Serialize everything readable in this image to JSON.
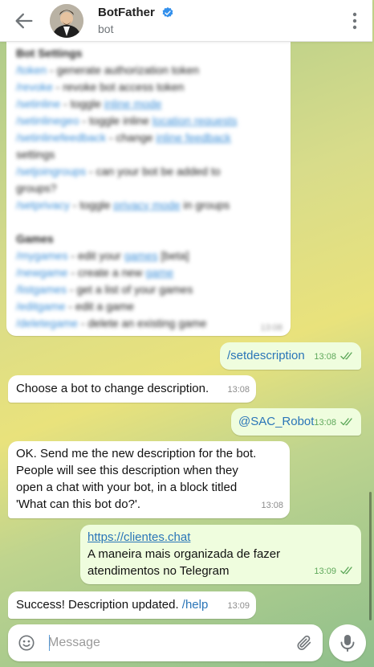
{
  "header": {
    "title": "BotFather",
    "subtitle": "bot",
    "back_icon": "arrow-left-icon",
    "verified_icon": "verified-badge-icon",
    "menu_icon": "more-vertical-icon"
  },
  "previous_message": {
    "lines": [
      {
        "kind": "section",
        "text": "Bot Settings"
      },
      {
        "kind": "line",
        "cmd": "/token",
        "text": " - generate authorization token"
      },
      {
        "kind": "line",
        "cmd": "/revoke",
        "text": " - revoke bot access token"
      },
      {
        "kind": "line",
        "cmd": "/setinline",
        "text": " - toggle ",
        "link": "inline mode"
      },
      {
        "kind": "line",
        "cmd": "/setinlinegeo",
        "text": " - toggle inline ",
        "link": "location requests"
      },
      {
        "kind": "line",
        "cmd": "/setinlinefeedback",
        "text": " - change ",
        "link": "inline feedback"
      },
      {
        "kind": "plain",
        "text": "settings"
      },
      {
        "kind": "line",
        "cmd": "/setjoingroups",
        "text": " - can your bot be added to"
      },
      {
        "kind": "plain",
        "text": "groups?"
      },
      {
        "kind": "line",
        "cmd": "/setprivacy",
        "text": " - toggle ",
        "link": "privacy mode",
        "after": " in groups"
      },
      {
        "kind": "blank",
        "text": ""
      },
      {
        "kind": "section",
        "text": "Games"
      },
      {
        "kind": "line",
        "cmd": "/mygames",
        "text": " - edit your ",
        "link": "games",
        "after": " [beta]"
      },
      {
        "kind": "line",
        "cmd": "/newgame",
        "text": " - create a new ",
        "link": "game"
      },
      {
        "kind": "line",
        "cmd": "/listgames",
        "text": " - get a list of your games"
      },
      {
        "kind": "line",
        "cmd": "/editgame",
        "text": " - edit a game"
      },
      {
        "kind": "line",
        "cmd": "/deletegame",
        "text": " - delete an existing game"
      }
    ],
    "time": "13:08"
  },
  "messages": {
    "m1": {
      "text": "/setdescription",
      "time": "13:08"
    },
    "m2": {
      "text": "Choose a bot to change description.",
      "time": "13:08"
    },
    "m3": {
      "text": "@SAC_Robot",
      "time": "13:08"
    },
    "m4": {
      "line1": "OK. Send me the new description for the bot.",
      "line2": "People will see this description when they",
      "line3": "open a chat with your bot, in a block titled",
      "line4": "'What can this bot do?'.",
      "time": "13:08"
    },
    "m5": {
      "link": "https://clientes.chat",
      "line1": "A maneira mais organizada de fazer",
      "line2": "atendimentos no Telegram",
      "time": "13:09"
    },
    "m6": {
      "text": "Success! Description updated.",
      "cmd": "/help",
      "time": "13:09"
    }
  },
  "composer": {
    "placeholder": "Message",
    "emoji_icon": "emoji-icon",
    "attach_icon": "paperclip-icon",
    "mic_icon": "microphone-icon"
  },
  "colors": {
    "accent": "#2a75b8",
    "outgoing_bubble": "#effdde",
    "incoming_bubble": "#ffffff",
    "read_ticks": "#5ea85a",
    "verified": "#3390ec"
  }
}
